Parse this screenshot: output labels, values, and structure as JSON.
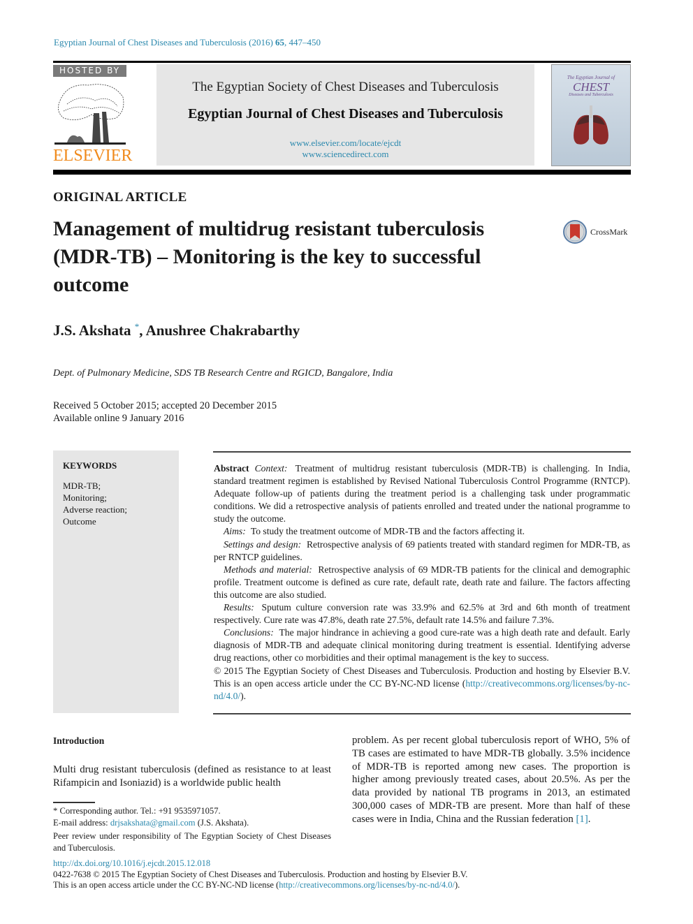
{
  "running_head": {
    "journal": "Egyptian Journal of Chest Diseases and Tuberculosis (2016)",
    "volume": "65",
    "pages": ", 447–450"
  },
  "masthead": {
    "hosted_by": "HOSTED BY",
    "publisher_logo": "ELSEVIER",
    "society": "The Egyptian Society of Chest Diseases and Tuberculosis",
    "journal_title": "Egyptian Journal of Chest Diseases and Tuberculosis",
    "url_journal": "www.elsevier.com/locate/ejcdt",
    "url_sciencedirect": "www.sciencedirect.com",
    "cover": {
      "line1": "The Egyptian Journal of",
      "line2": "CHEST",
      "line3": "Diseases and Tuberculosis"
    }
  },
  "article": {
    "section": "ORIGINAL ARTICLE",
    "title": "Management of multidrug resistant tuberculosis (MDR-TB) – Monitoring is the key to successful outcome",
    "crossmark_label": "CrossMark",
    "author1": "J.S. Akshata",
    "author1_mark": "*",
    "author_sep": ", ",
    "author2": "Anushree Chakrabarthy",
    "affiliation": "Dept. of Pulmonary Medicine, SDS TB Research Centre and RGICD, Bangalore, India",
    "received": "Received 5 October 2015; accepted 20 December 2015",
    "available": "Available online 9 January 2016"
  },
  "keywords": {
    "heading": "KEYWORDS",
    "items": [
      "MDR-TB;",
      "Monitoring;",
      "Adverse reaction;",
      "Outcome"
    ]
  },
  "abstract": {
    "label": "Abstract",
    "context_label": "Context:",
    "context": "Treatment of multidrug resistant tuberculosis (MDR-TB) is challenging. In India, standard treatment regimen is established by Revised National Tuberculosis Control Programme (RNTCP). Adequate follow-up of patients during the treatment period is a challenging task under programmatic conditions. We did a retrospective analysis of patients enrolled and treated under the national programme to study the outcome.",
    "aims_label": "Aims:",
    "aims": "To study the treatment outcome of MDR-TB and the factors affecting it.",
    "settings_label": "Settings and design:",
    "settings": "Retrospective analysis of 69 patients treated with standard regimen for MDR-TB, as per RNTCP guidelines.",
    "methods_label": "Methods and material:",
    "methods": "Retrospective analysis of 69 MDR-TB patients for the clinical and demographic profile. Treatment outcome is defined as cure rate, default rate, death rate and failure. The factors affecting this outcome are also studied.",
    "results_label": "Results:",
    "results": "Sputum culture conversion rate was 33.9% and 62.5% at 3rd and 6th month of treatment respectively. Cure rate was 47.8%, death rate 27.5%, default rate 14.5% and failure 7.3%.",
    "conclusions_label": "Conclusions:",
    "conclusions": "The major hindrance in achieving a good cure-rate was a high death rate and default. Early diagnosis of MDR-TB and adequate clinical monitoring during treatment is essential. Identifying adverse drug reactions, other co morbidities and their optimal management is the key to success.",
    "copyright": "© 2015 The Egyptian Society of Chest Diseases and Tuberculosis. Production and hosting by Elsevier B.V. This is an open access article under the CC BY-NC-ND license (",
    "license_url": "http://creativecommons.org/licenses/by-nc-nd/4.0/",
    "copyright_end": ")."
  },
  "introduction": {
    "heading": "Introduction",
    "para_left": "Multi drug resistant tuberculosis (defined as resistance to at least Rifampicin and Isoniazid) is a worldwide public health",
    "para_right": "problem. As per recent global tuberculosis report of WHO, 5% of TB cases are estimated to have MDR-TB globally. 3.5% incidence of MDR-TB is reported among new cases. The proportion is higher among previously treated cases, about 20.5%. As per the data provided by national TB programs in 2013, an estimated 300,000 cases of MDR-TB are present. More than half of these cases were in India, China and the Russian federation ",
    "ref": "[1]",
    "para_right_end": "."
  },
  "footnotes": {
    "corresponding": "* Corresponding author. Tel.: +91 9535971057.",
    "email_label": "E-mail address: ",
    "email": "drjsakshata@gmail.com",
    "email_owner": " (J.S. Akshata).",
    "peer_review": "Peer review under responsibility of The Egyptian Society of Chest Diseases and Tuberculosis."
  },
  "bottom": {
    "doi": "http://dx.doi.org/10.1016/j.ejcdt.2015.12.018",
    "issn_line": "0422-7638 © 2015 The Egyptian Society of Chest Diseases and Tuberculosis. Production and hosting by Elsevier B.V.",
    "license_prefix": "This is an open access article under the CC BY-NC-ND license (",
    "license_url": "http://creativecommons.org/licenses/by-nc-nd/4.0/",
    "license_suffix": ")."
  },
  "colors": {
    "link": "#2a88ad",
    "elsevier_orange": "#f08a1c",
    "panel_gray": "#e6e6e6"
  }
}
